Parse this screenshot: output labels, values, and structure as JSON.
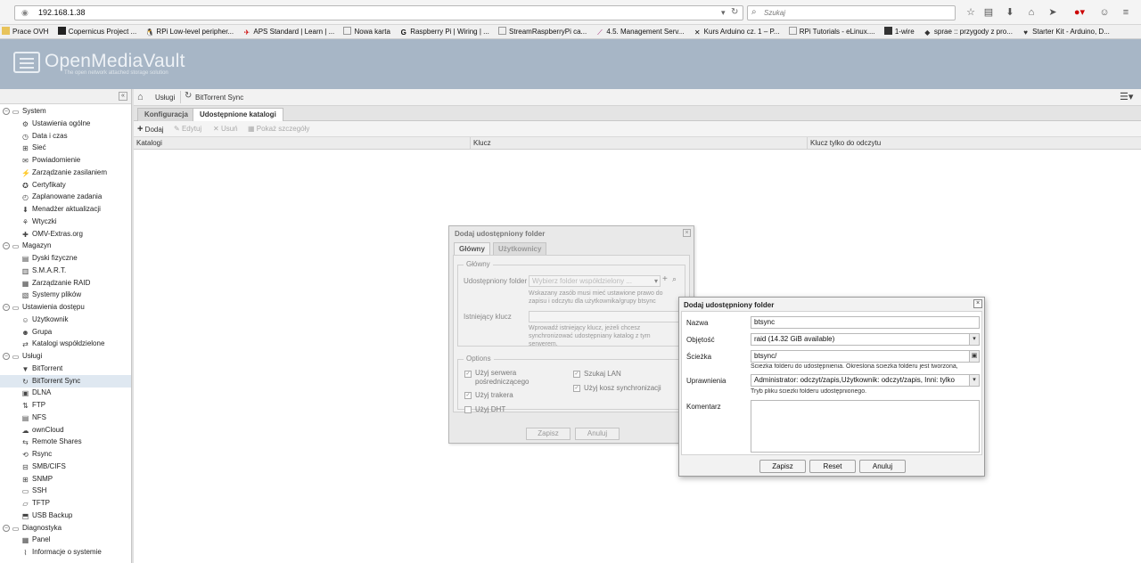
{
  "browser": {
    "url": "192.168.1.38",
    "search_placeholder": "Szukaj",
    "bookmarks": [
      "Prace OVH",
      "Copernicus Project ...",
      "RPi Low-level peripher...",
      "APS Standard | Learn | ...",
      "Nowa karta",
      "Raspberry Pi | Wiring | ...",
      "StreamRaspberryPi ca...",
      "4.5. Management Serv...",
      "Kurs Arduino cz. 1 – P...",
      "RPi Tutorials - eLinux....",
      "1-wire",
      "sprae :: przygody z pro...",
      "Starter Kit - Arduino, D..."
    ]
  },
  "header": {
    "title": "OpenMediaVault",
    "subtitle": "The open network attached storage solution"
  },
  "sidebar": {
    "collapse_label": "«",
    "tree": [
      {
        "label": "System",
        "group": true
      },
      {
        "label": "Ustawienia ogólne"
      },
      {
        "label": "Data i czas"
      },
      {
        "label": "Sieć"
      },
      {
        "label": "Powiadomienie"
      },
      {
        "label": "Zarządzanie zasilaniem"
      },
      {
        "label": "Certyfikaty"
      },
      {
        "label": "Zaplanowane zadania"
      },
      {
        "label": "Menadżer aktualizacji"
      },
      {
        "label": "Wtyczki"
      },
      {
        "label": "OMV-Extras.org"
      },
      {
        "label": "Magazyn",
        "group": true
      },
      {
        "label": "Dyski fizyczne"
      },
      {
        "label": "S.M.A.R.T."
      },
      {
        "label": "Zarządzanie RAID"
      },
      {
        "label": "Systemy plików"
      },
      {
        "label": "Ustawienia dostępu",
        "group": true
      },
      {
        "label": "Użytkownik"
      },
      {
        "label": "Grupa"
      },
      {
        "label": "Katalogi współdzielone"
      },
      {
        "label": "Usługi",
        "group": true
      },
      {
        "label": "BitTorrent"
      },
      {
        "label": "BitTorrent Sync",
        "selected": true
      },
      {
        "label": "DLNA"
      },
      {
        "label": "FTP"
      },
      {
        "label": "NFS"
      },
      {
        "label": "ownCloud"
      },
      {
        "label": "Remote Shares"
      },
      {
        "label": "Rsync"
      },
      {
        "label": "SMB/CIFS"
      },
      {
        "label": "SNMP"
      },
      {
        "label": "SSH"
      },
      {
        "label": "TFTP"
      },
      {
        "label": "USB Backup"
      },
      {
        "label": "Diagnostyka",
        "group": true
      },
      {
        "label": "Panel"
      },
      {
        "label": "Informacje o systemie"
      }
    ]
  },
  "breadcrumb": {
    "home": "Usługi",
    "current": "BitTorrent Sync"
  },
  "tabs": [
    "Konfiguracja",
    "Udostępnione katalogi"
  ],
  "toolbar": {
    "add": "Dodaj",
    "edit": "Edytuj",
    "delete": "Usuń",
    "details": "Pokaż szczegóły"
  },
  "grid": {
    "columns": [
      "Katalogi",
      "Klucz",
      "Klucz tylko do odczytu"
    ]
  },
  "dialog1": {
    "title": "Dodaj udostępniony folder",
    "tabs": [
      "Główny",
      "Użytkownicy"
    ],
    "section_main": "Główny",
    "shared_label": "Udostępniony folder",
    "shared_placeholder": "Wybierz folder współdzielony ...",
    "shared_hint": "Wskazany zasób musi mieć ustawione prawo do zapisu i odczytu dla użytkownika/grupy btsync",
    "key_label": "Istniejący klucz",
    "key_hint": "Wprowadź istniejący klucz, jeżeli chcesz synchronizować udostępniany katalog z tym serwerem.",
    "section_options": "Options",
    "opt_proxy": "Użyj serwera pośredniczącego",
    "opt_tracker": "Użyj trakera",
    "opt_dht": "Użyj DHT",
    "opt_lan": "Szukaj LAN",
    "opt_trash": "Użyj kosz synchronizacji",
    "save": "Zapisz",
    "cancel": "Anuluj"
  },
  "dialog2": {
    "title": "Dodaj udostępniony folder",
    "name_label": "Nazwa",
    "name_value": "btsync",
    "volume_label": "Objętość",
    "volume_value": "raid (14.32 GiB available)",
    "path_label": "Ścieżka",
    "path_value": "btsync/",
    "path_hint": "Ścieżka folderu do udostępnienia. Określona ścieżka folderu jest tworzona,",
    "perm_label": "Uprawnienia",
    "perm_value": "Administrator: odczyt/zapis,Użytkownik: odczyt/zapis, Inni: tylko",
    "perm_hint": "Tryb pliku ścieżki folderu udostępnionego.",
    "comment_label": "Komentarz",
    "save": "Zapisz",
    "reset": "Reset",
    "cancel": "Anuluj"
  }
}
